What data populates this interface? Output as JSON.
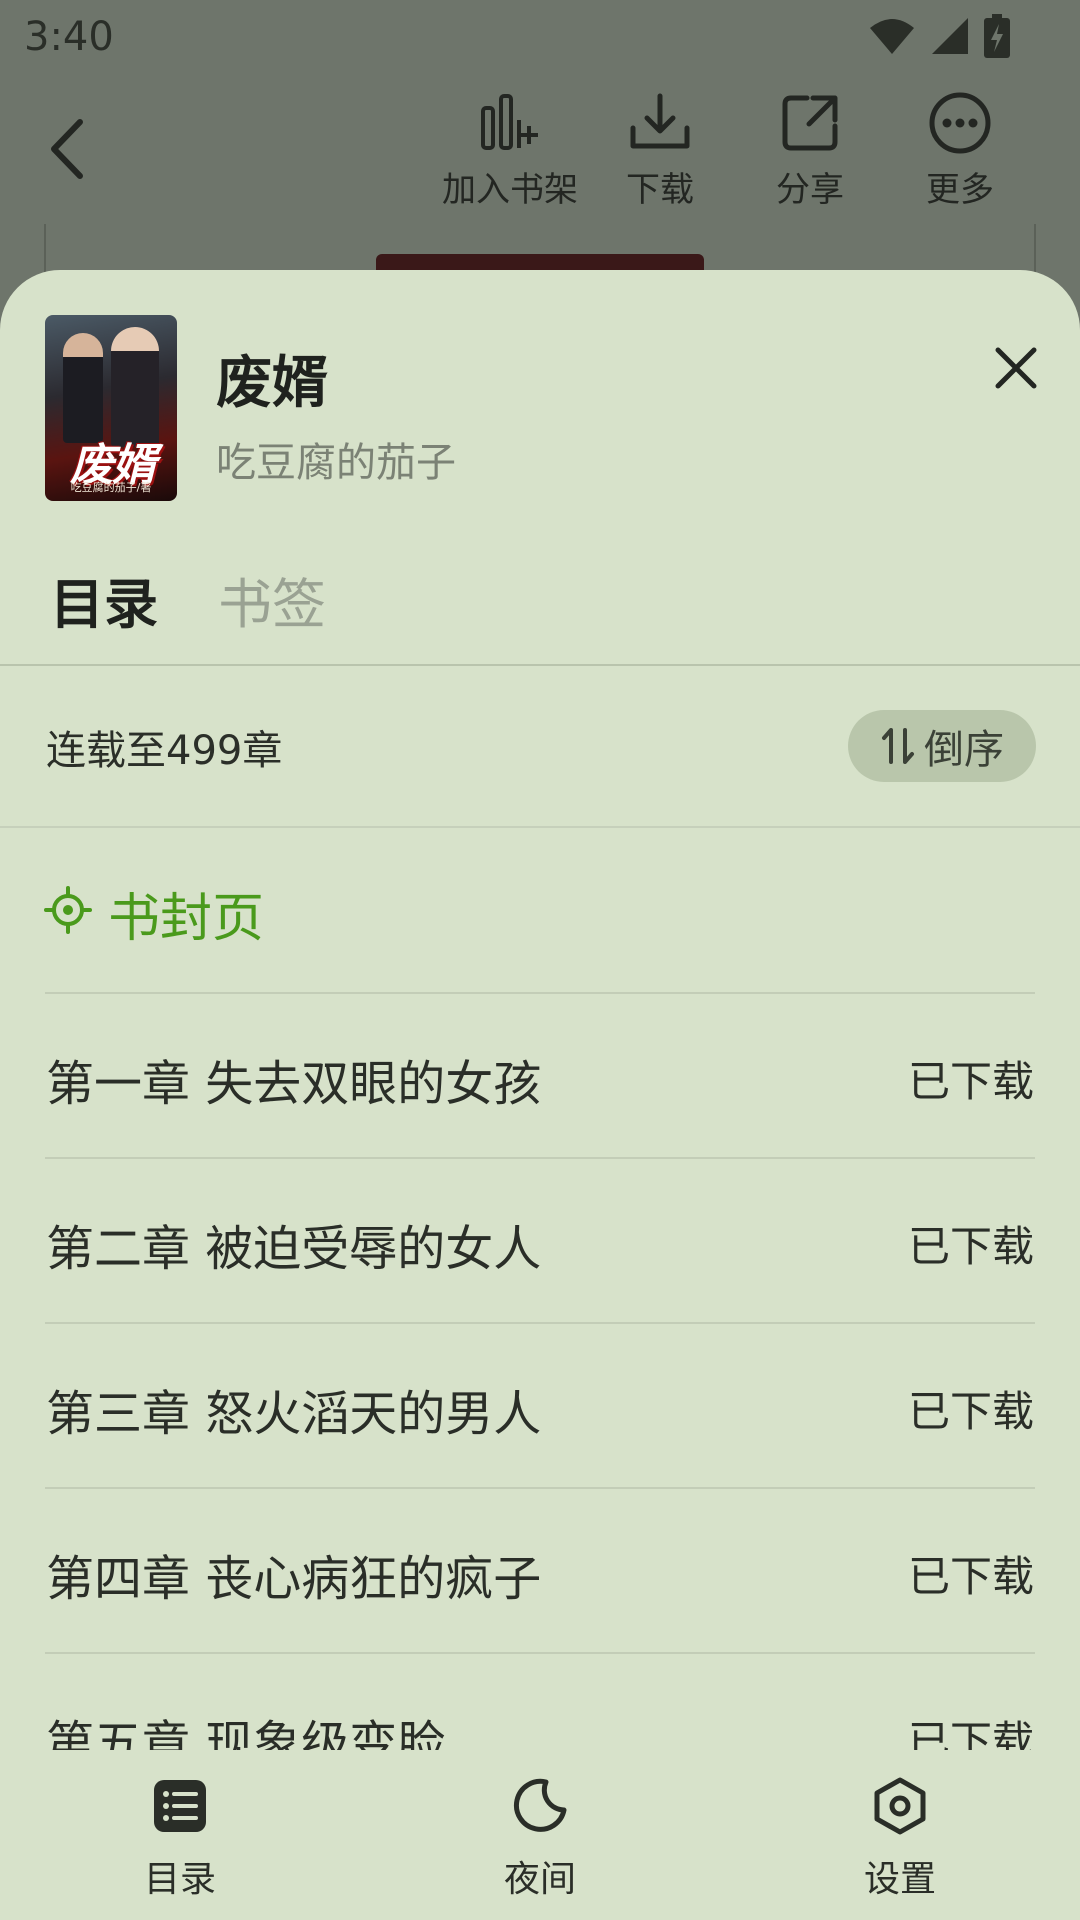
{
  "status_bar": {
    "time": "3:40"
  },
  "top_bar": {
    "actions": [
      {
        "label": "加入书架",
        "icon": "add-to-shelf-icon"
      },
      {
        "label": "下载",
        "icon": "download-icon"
      },
      {
        "label": "分享",
        "icon": "share-icon"
      },
      {
        "label": "更多",
        "icon": "more-icon"
      }
    ]
  },
  "book": {
    "title": "废婿",
    "author": "吃豆腐的茄子",
    "cover_title": "废婿",
    "cover_author": "吃豆腐的茄子/著"
  },
  "tabs": [
    {
      "label": "目录",
      "active": true
    },
    {
      "label": "书签",
      "active": false
    }
  ],
  "toc": {
    "serial_status": "连载至499章",
    "sort_label": "倒序",
    "cover_page_label": "书封页",
    "accent_color": "#4a9a1c",
    "chapters": [
      {
        "title": "第一章 失去双眼的女孩",
        "status": "已下载"
      },
      {
        "title": "第二章 被迫受辱的女人",
        "status": "已下载"
      },
      {
        "title": "第三章 怒火滔天的男人",
        "status": "已下载"
      },
      {
        "title": "第四章 丧心病狂的疯子",
        "status": "已下载"
      },
      {
        "title": "第五章 现象级变脸",
        "status": "已下载"
      }
    ]
  },
  "bottom_nav": [
    {
      "label": "目录",
      "icon": "list-icon"
    },
    {
      "label": "夜间",
      "icon": "moon-icon"
    },
    {
      "label": "设置",
      "icon": "settings-icon"
    }
  ]
}
